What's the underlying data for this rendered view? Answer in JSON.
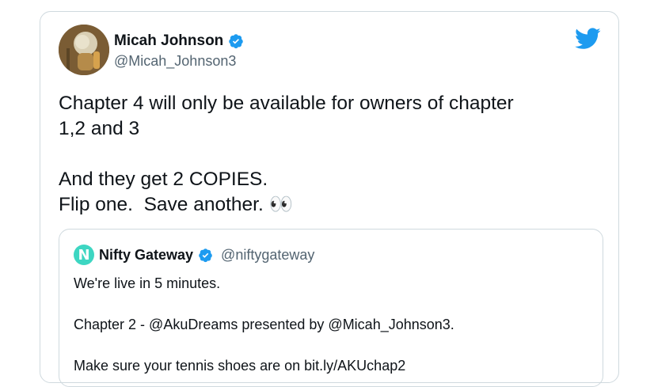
{
  "tweet": {
    "author_name": "Micah Johnson",
    "author_handle": "@Micah_Johnson3",
    "verified_icon": "verified-badge-icon",
    "brand_icon": "twitter-bird-icon",
    "text_lines": [
      "Chapter 4 will only be available for owners of chapter",
      "1,2 and 3",
      "",
      "And they get 2 COPIES.",
      "Flip one.  Save another. 👀"
    ]
  },
  "quoted_tweet": {
    "avatar_letter": "N",
    "author_name": "Nifty Gateway",
    "author_handle": "@niftygateway",
    "text_lines": [
      "We're live in 5 minutes.",
      "",
      "Chapter 2 - @AkuDreams presented by @Micah_Johnson3.",
      "",
      "Make sure your tennis shoes are on bit.ly/AKUchap2"
    ]
  },
  "colors": {
    "twitter_blue": "#1d9bf0",
    "border": "#cfd9de",
    "secondary_text": "#536471",
    "nifty_teal": "#3dd6c2"
  }
}
